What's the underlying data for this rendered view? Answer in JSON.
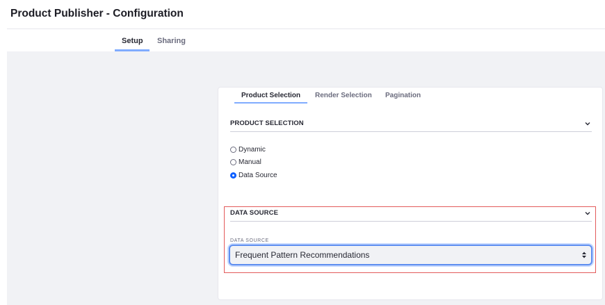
{
  "page": {
    "title": "Product Publisher - Configuration"
  },
  "top_tabs": [
    {
      "label": "Setup",
      "active": true
    },
    {
      "label": "Sharing",
      "active": false
    }
  ],
  "sub_tabs": [
    {
      "label": "Product Selection",
      "active": true
    },
    {
      "label": "Render Selection",
      "active": false
    },
    {
      "label": "Pagination",
      "active": false
    }
  ],
  "product_selection": {
    "title": "PRODUCT SELECTION",
    "options": [
      {
        "label": "Dynamic",
        "checked": false
      },
      {
        "label": "Manual",
        "checked": false
      },
      {
        "label": "Data Source",
        "checked": true
      }
    ]
  },
  "data_source": {
    "title": "DATA SOURCE",
    "field_label": "DATA SOURCE",
    "selected_value": "Frequent Pattern Recommendations"
  },
  "colors": {
    "accent": "#0b5fff",
    "tab_underline": "#80acff",
    "highlight_border": "#e35a5a",
    "background_gray": "#f1f2f5"
  }
}
